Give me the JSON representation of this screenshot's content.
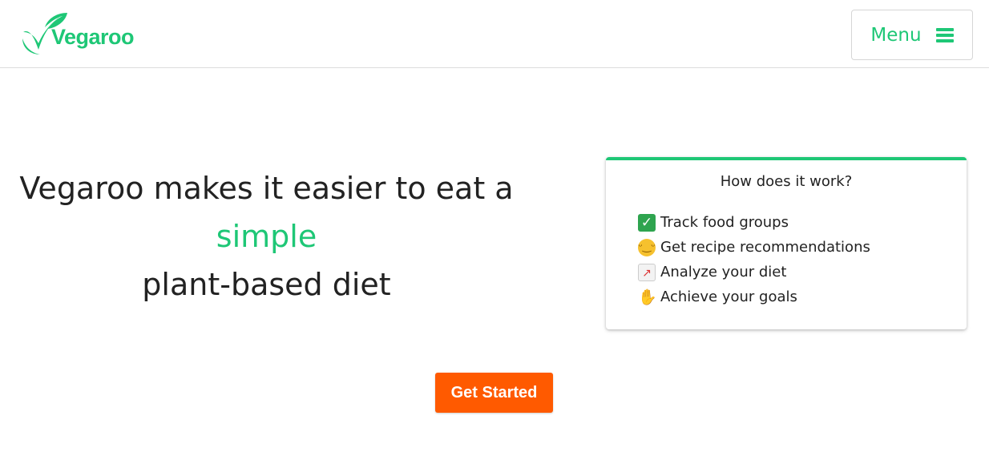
{
  "colors": {
    "brand_green": "#1ec776",
    "cta_orange": "#ff5a00",
    "text": "#222222",
    "border": "#d6d6d6"
  },
  "header": {
    "logo_text": "Vegaroo",
    "menu_label": "Menu",
    "menu_icon": "hamburger-icon"
  },
  "hero": {
    "line1": "Vegaroo makes it easier to eat a",
    "highlight": "simple",
    "line3": "plant-based diet"
  },
  "how_it_works": {
    "title": "How does it work?",
    "steps": [
      {
        "icon": "check-mark-icon",
        "label": "Track food groups"
      },
      {
        "icon": "yum-face-icon",
        "label": "Get recipe recommendations"
      },
      {
        "icon": "chart-increasing-icon",
        "label": "Analyze your diet"
      },
      {
        "icon": "raising-hands-icon",
        "label": "Achieve your goals"
      }
    ]
  },
  "cta": {
    "label": "Get Started"
  }
}
